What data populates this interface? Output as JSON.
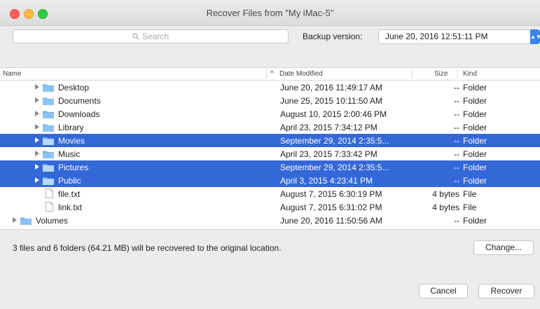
{
  "window": {
    "title": "Recover Files from \"My iMac-5\""
  },
  "search": {
    "placeholder": "Search"
  },
  "backup": {
    "label": "Backup version:",
    "value": "June 20, 2016 12:51:11 PM"
  },
  "table": {
    "columns": {
      "name": "Name",
      "date": "Date Modified",
      "size": "Size",
      "kind": "Kind"
    },
    "rows": [
      {
        "name": "Desktop",
        "date": "June 20, 2016 11:49:17 AM",
        "size": "--",
        "kind": "Folder",
        "type": "folder",
        "indent": 1,
        "selected": false
      },
      {
        "name": "Documents",
        "date": "June 25, 2015 10:11:50 AM",
        "size": "--",
        "kind": "Folder",
        "type": "folder",
        "indent": 1,
        "selected": false
      },
      {
        "name": "Downloads",
        "date": "August 10, 2015 2:00:46 PM",
        "size": "--",
        "kind": "Folder",
        "type": "folder",
        "indent": 1,
        "selected": false
      },
      {
        "name": "Library",
        "date": "April 23, 2015 7:34:12 PM",
        "size": "--",
        "kind": "Folder",
        "type": "folder",
        "indent": 1,
        "selected": false
      },
      {
        "name": "Movies",
        "date": "September 29, 2014 2:35:5...",
        "size": "--",
        "kind": "Folder",
        "type": "folder",
        "indent": 1,
        "selected": true
      },
      {
        "name": "Music",
        "date": "April 23, 2015 7:33:42 PM",
        "size": "--",
        "kind": "Folder",
        "type": "folder",
        "indent": 1,
        "selected": false
      },
      {
        "name": "Pictures",
        "date": "September 29, 2014 2:35:5...",
        "size": "--",
        "kind": "Folder",
        "type": "folder",
        "indent": 1,
        "selected": true
      },
      {
        "name": "Public",
        "date": "April 3, 2015 4:23:41 PM",
        "size": "--",
        "kind": "Folder",
        "type": "folder",
        "indent": 1,
        "selected": true
      },
      {
        "name": "file.txt",
        "date": "August 7, 2015 6:30:19 PM",
        "size": "4 bytes",
        "kind": "File",
        "type": "file",
        "indent": 1,
        "selected": false
      },
      {
        "name": "link.txt",
        "date": "August 7, 2015 6:31:02 PM",
        "size": "4 bytes",
        "kind": "File",
        "type": "file",
        "indent": 1,
        "selected": false
      },
      {
        "name": "Volumes",
        "date": "June 20, 2016 11:50:56 AM",
        "size": "--",
        "kind": "Folder",
        "type": "folder",
        "indent": 0,
        "selected": false
      }
    ]
  },
  "status": {
    "text": "3 files and 6 folders (64.21 MB) will be recovered to the original location."
  },
  "buttons": {
    "change": "Change...",
    "cancel": "Cancel",
    "recover": "Recover"
  },
  "colors": {
    "selection": "#3467d8",
    "folder": "#6fb2f0",
    "accent": "#3a84f0"
  },
  "icons": {
    "folder": "folder-icon",
    "file": "file-icon",
    "disclosure": "disclosure-triangle-icon",
    "search": "search-icon"
  }
}
